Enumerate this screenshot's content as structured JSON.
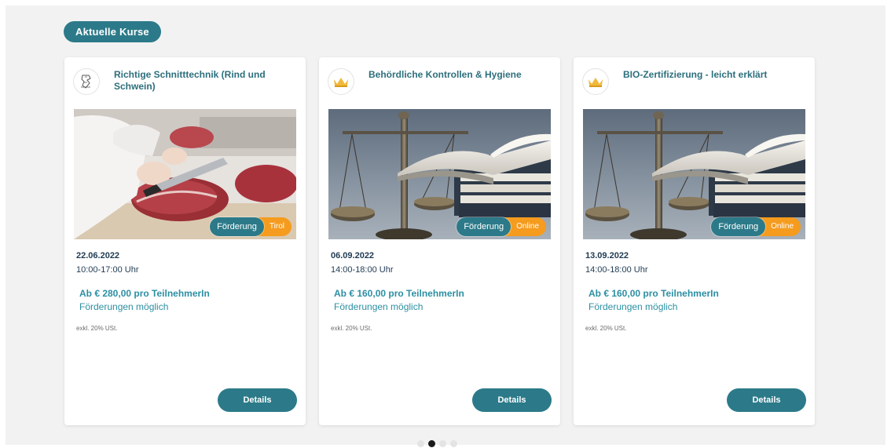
{
  "section": {
    "label": "Aktuelle Kurse"
  },
  "cards": [
    {
      "logo_icon": "butcher-logo-icon",
      "title": "Richtige Schnitttechnik (Rind und Schwein)",
      "image": "meat-cutting-photo",
      "badge_funding": "Förderung",
      "badge_region": "Tirol",
      "date": "22.06.2022",
      "time": "10:00-17:00 Uhr",
      "price": "Ab € 280,00 pro TeilnehmerIn",
      "funding": "Förderungen möglich",
      "tax": "exkl. 20% USt.",
      "button": "Details"
    },
    {
      "logo_icon": "crown-logo-icon",
      "title": "Behördliche Kontrollen & Hygiene",
      "image": "scales-of-justice-photo",
      "badge_funding": "Förderung",
      "badge_region": "Online",
      "date": "06.09.2022",
      "time": "14:00-18:00 Uhr",
      "price": "Ab € 160,00 pro TeilnehmerIn",
      "funding": "Förderungen möglich",
      "tax": "exkl. 20% USt.",
      "button": "Details"
    },
    {
      "logo_icon": "crown-logo-icon",
      "title": "BIO-Zertifizierung - leicht erklärt",
      "image": "scales-of-justice-photo",
      "badge_funding": "Förderung",
      "badge_region": "Online",
      "date": "13.09.2022",
      "time": "14:00-18:00 Uhr",
      "price": "Ab € 160,00 pro TeilnehmerIn",
      "funding": "Förderungen möglich",
      "tax": "exkl. 20% USt.",
      "button": "Details"
    }
  ],
  "pagination": {
    "total": 4,
    "active": 2
  },
  "colors": {
    "primary": "#2c7a89",
    "accent": "#f59b1e",
    "link": "#2c8fa3",
    "text_dark": "#1f3a52",
    "crown": "#f0b93a"
  }
}
